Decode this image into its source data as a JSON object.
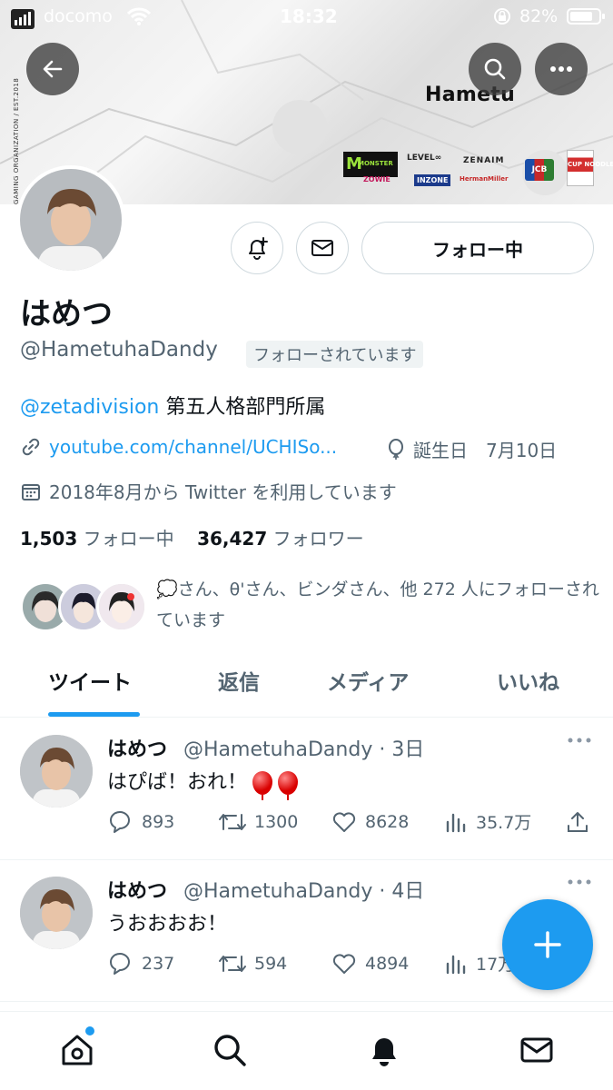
{
  "status_bar": {
    "carrier": "docomo",
    "time": "18:32",
    "battery": "82%"
  },
  "banner": {
    "brand": "Hametu",
    "side_text": "GAMING ORGANIZATION / EST.2018",
    "sponsors": [
      "MONSTER",
      "LEVEL∞",
      "ZENAIM",
      "ZOWIE",
      "INZONE",
      "HermanMiller",
      "JCB",
      "CUP NOODLE"
    ]
  },
  "profile": {
    "display_name": "はめつ",
    "handle": "@HametuhaDandy",
    "follows_you": "フォローされています",
    "follow_button": "フォロー中",
    "bio_mention": "@zetadivision",
    "bio_text": " 第五人格部門所属",
    "link": "youtube.com/channel/UCHISo...",
    "birthday": "誕生日　7月10日",
    "joined": "2018年8月から Twitter を利用しています",
    "following_count": "1,503",
    "following_label": "フォロー中",
    "followers_count": "36,427",
    "followers_label": "フォロワー",
    "followed_by": "💭さん、θ'さん、ビンダさん、他 272 人にフォローされています"
  },
  "tabs": [
    {
      "label": "ツイート",
      "active": true
    },
    {
      "label": "返信",
      "active": false
    },
    {
      "label": "メディア",
      "active": false
    },
    {
      "label": "いいね",
      "active": false
    }
  ],
  "tweets": [
    {
      "name": "はめつ",
      "meta": "@HametuhaDandy · 3日",
      "text": "はぴば！おれ！",
      "replies": "893",
      "retweets": "1300",
      "likes": "8628",
      "views": "35.7万"
    },
    {
      "name": "はめつ",
      "meta": "@HametuhaDandy · 4日",
      "text": "うおおおお！",
      "replies": "237",
      "retweets": "594",
      "likes": "4894",
      "views": "17万"
    }
  ],
  "colors": {
    "accent": "#1d9bf0",
    "text": "#0f1419",
    "secondary": "#536471"
  }
}
